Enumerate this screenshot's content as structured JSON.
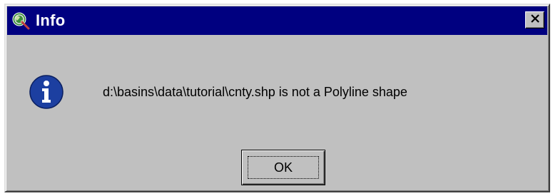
{
  "dialog": {
    "title": "Info",
    "title_icon": "globe-magnifier-icon",
    "close_icon": "close-icon",
    "message_icon": "info-icon",
    "message": "d:\\basins\\data\\tutorial\\cnty.shp is not a Polyline shape",
    "ok_label": "OK"
  },
  "colors": {
    "titlebar": "#000080",
    "title_text": "#ffffff",
    "window_face": "#c0c0c0",
    "info_icon_fill": "#1c3fa0"
  }
}
